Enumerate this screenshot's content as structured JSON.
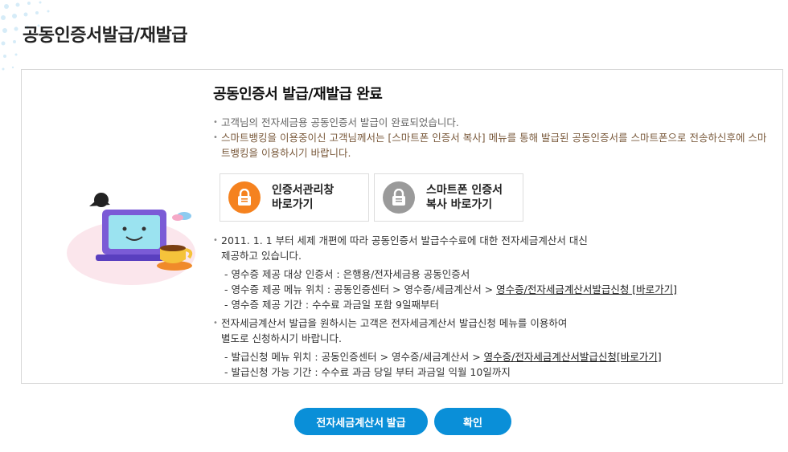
{
  "page": {
    "title": "공동인증서발급/재발급"
  },
  "panel": {
    "done_title": "공동인증서 발급/재발급 완료",
    "notices": [
      "고객님의 전자세금용 공동인증서 발급이 완료되었습니다.",
      "스마트뱅킹을 이용중이신 고객님께서는 [스마트폰 인증서 복사] 메뉴를 통해 발급된 공동인증서를 스마트폰으로 전송하신후에 스마트뱅킹을 이용하시기 바랍니다."
    ],
    "quick_buttons": [
      {
        "label_line1": "인증서관리창",
        "label_line2": "바로가기",
        "icon": "lock-icon",
        "color": "#f5821f"
      },
      {
        "label_line1": "스마트폰 인증서",
        "label_line2": "복사 바로가기",
        "icon": "lock-icon",
        "color": "#9a9a9a"
      }
    ],
    "info": {
      "b1_line1": "2011. 1. 1 부터 세제 개편에 따라 공동인증서 발급수수료에 대한 전자세금계산서 대신",
      "b1_line2": "제공하고 있습니다.",
      "b1_sub1": "- 영수증 제공 대상 인증서 : 은행용/전자세금용 공동인증서",
      "b1_sub2_prefix": "- 영수증 제공 메뉴 위치 : 공동인증센터 > 영수증/세금계산서 > ",
      "b1_sub2_link": "영수증/전자세금계산서발급신청 [바로가기]",
      "b1_sub3": "- 영수증 제공 기간 : 수수료 과금일 포함 9일째부터",
      "b2_line1": "전자세금계산서 발급을 원하시는 고객은 전자세금계산서 발급신청 메뉴를 이용하여",
      "b2_line2": "별도로 신청하시기 바랍니다.",
      "b2_sub1_prefix": "- 발급신청 메뉴 위치 : 공동인증센터 > 영수증/세금계산서 > ",
      "b2_sub1_link": "영수증/전자세금계산서발급신청[바로가기]",
      "b2_sub2": "- 발급신청 가능 기간 : 수수료 과금 당일 부터 과금일 익월 10일까지"
    }
  },
  "buttons": {
    "issue": "전자세금계산서 발급",
    "confirm": "확인"
  },
  "colors": {
    "accent": "#0a8fd8",
    "orange": "#f5821f",
    "notice": "#7a5a3c"
  }
}
